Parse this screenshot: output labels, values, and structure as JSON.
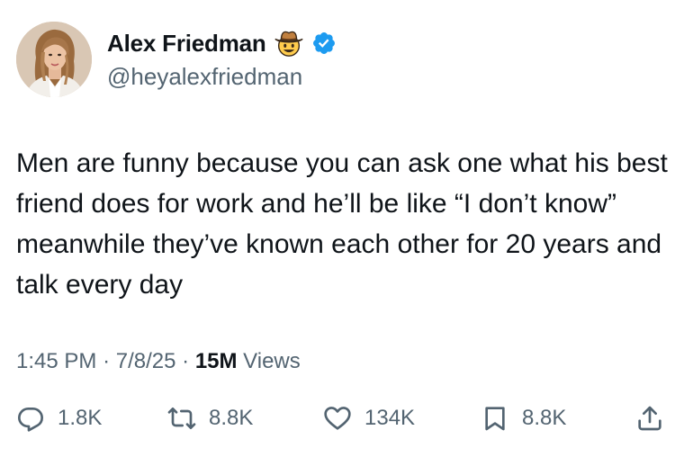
{
  "author": {
    "display_name": "Alex Friedman",
    "emoji_icon": "cowboy-hat-face-icon",
    "verified_icon": "verified-badge-icon",
    "handle": "@heyalexfriedman"
  },
  "tweet": {
    "text": "Men are funny because you can ask one what his best friend does for work and he’ll be like “I don’t know” meanwhile they’ve known each other for 20 years and talk every day"
  },
  "meta": {
    "time": "1:45 PM",
    "separator": "·",
    "date": "7/8/25",
    "views_count": "15M",
    "views_label": "Views"
  },
  "actions": {
    "replies": "1.8K",
    "reposts": "8.8K",
    "likes": "134K",
    "bookmarks": "8.8K"
  },
  "colors": {
    "text_primary": "#0f1419",
    "text_secondary": "#536471",
    "verified_blue": "#1d9bf0"
  }
}
